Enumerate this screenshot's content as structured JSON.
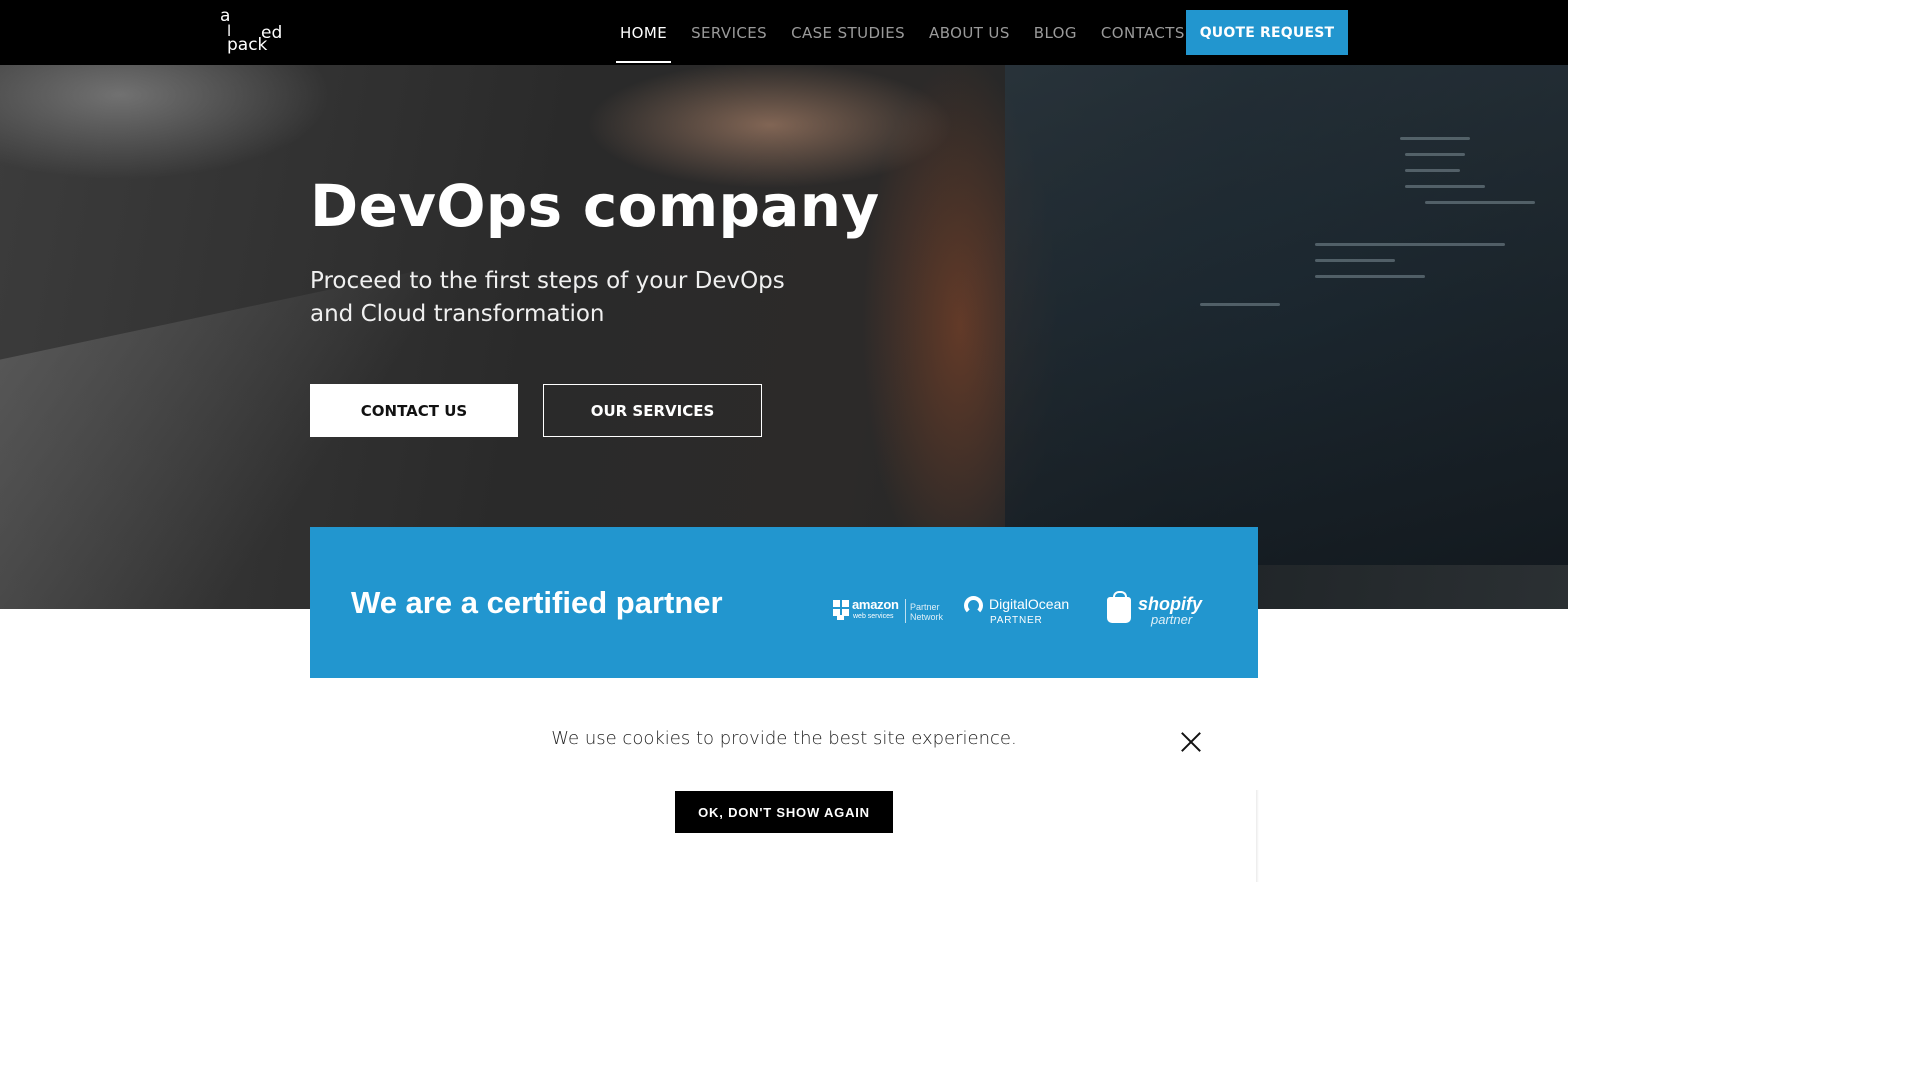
{
  "brand": {
    "logo_parts": [
      "a",
      "l",
      "ed",
      "pack"
    ]
  },
  "nav": {
    "items": [
      {
        "label": "HOME",
        "active": true
      },
      {
        "label": "SERVICES",
        "active": false
      },
      {
        "label": "CASE STUDIES",
        "active": false
      },
      {
        "label": "ABOUT US",
        "active": false
      },
      {
        "label": "BLOG",
        "active": false
      },
      {
        "label": "CONTACTS",
        "active": false
      }
    ],
    "cta_label": "QUOTE REQUEST"
  },
  "hero": {
    "title": "DevOps company",
    "subtitle": "Proceed to the first steps of your DevOps and Cloud transformation",
    "primary_button": "CONTACT US",
    "secondary_button": "OUR SERVICES"
  },
  "partners": {
    "title": "We are a certified partner",
    "aws": {
      "name": "amazon",
      "sub": "web services",
      "badge": "Partner Network"
    },
    "digitalocean": {
      "name": "DigitalOcean",
      "sub": "PARTNER"
    },
    "shopify": {
      "name": "shopify",
      "sub": "partner"
    }
  },
  "cookie": {
    "message": "We use cookies to provide the best site experience.",
    "ok_label": "OK, DON'T SHOW AGAIN"
  },
  "colors": {
    "accent": "#2296cf",
    "header_bg": "#000000",
    "cookie_button_bg": "#000000"
  }
}
